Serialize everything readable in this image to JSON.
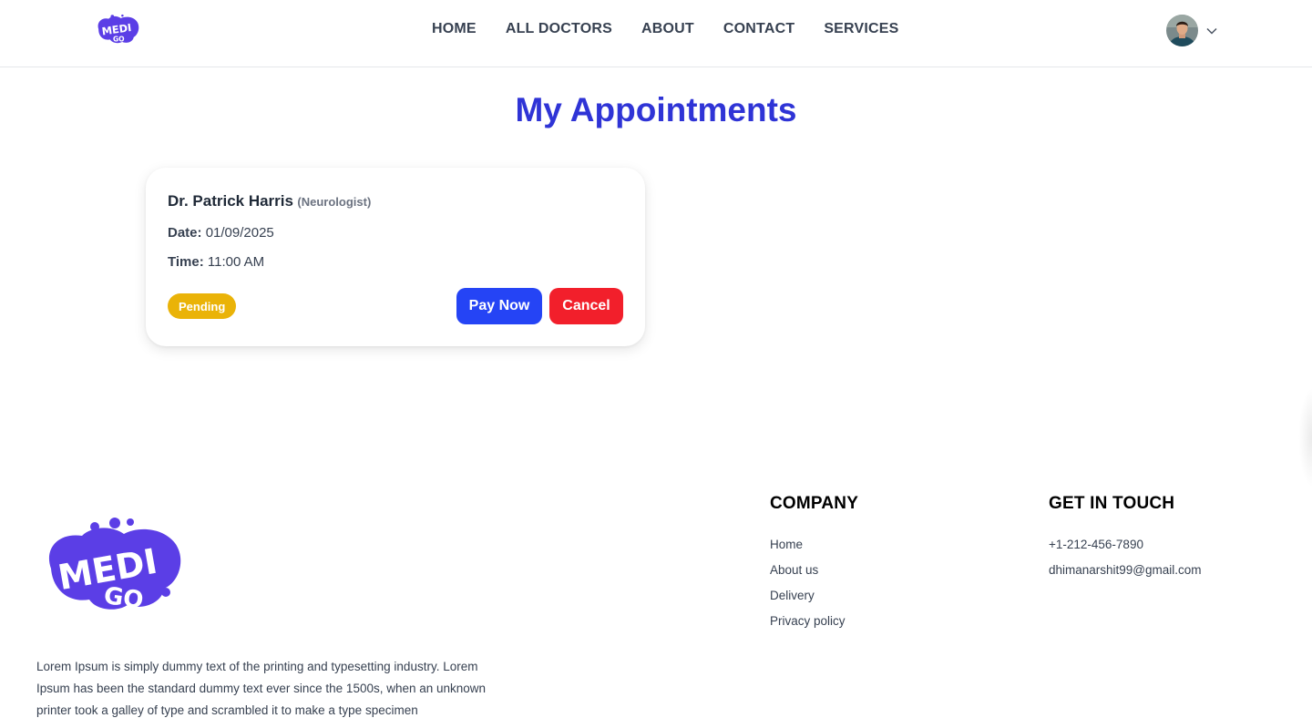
{
  "brand": {
    "logo_text": "MEDI GO",
    "accent": "#2f34d6",
    "logo_color": "#5b3ee6"
  },
  "nav": {
    "items": [
      "HOME",
      "ALL DOCTORS",
      "ABOUT",
      "CONTACT",
      "SERVICES"
    ]
  },
  "profile": {
    "avatar_icon": "user-avatar",
    "chevron_icon": "chevron-down-icon"
  },
  "page": {
    "title": "My Appointments"
  },
  "appointment": {
    "doctor": "Dr. Patrick Harris",
    "specialty": "(Neurologist)",
    "date_label": "Date:",
    "date": "01/09/2025",
    "time_label": "Time:",
    "time": "11:00 AM",
    "status": "Pending",
    "status_color": "#eab308",
    "pay_label": "Pay Now",
    "pay_color": "#2544f5",
    "cancel_label": "Cancel",
    "cancel_color": "#f21f2b"
  },
  "footer": {
    "about": "Lorem Ipsum is simply dummy text of the printing and typesetting industry. Lorem Ipsum has been the standard dummy text ever since the 1500s, when an unknown printer took a galley of type and scrambled it to make a type specimen",
    "company_title": "COMPANY",
    "company_links": [
      "Home",
      "About us",
      "Delivery",
      "Privacy policy"
    ],
    "contact_title": "GET IN TOUCH",
    "phone": "+1-212-456-7890",
    "email": "dhimanarshit99@gmail.com"
  }
}
